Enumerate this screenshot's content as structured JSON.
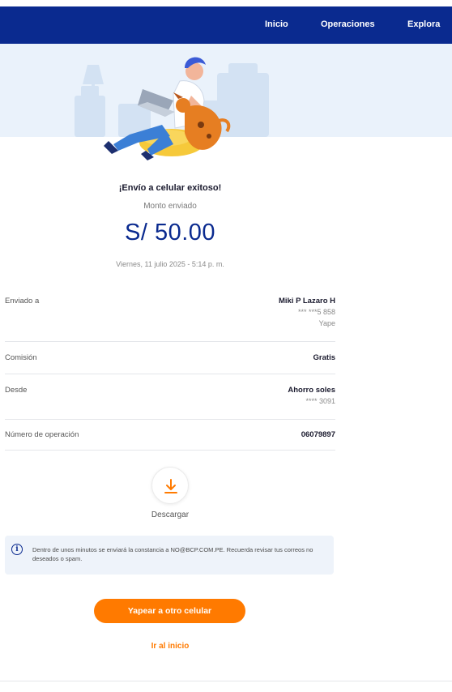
{
  "nav": {
    "items": [
      "Inicio",
      "Operaciones",
      "Explora"
    ]
  },
  "receipt": {
    "title": "¡Envío a celular exitoso!",
    "amount_label": "Monto enviado",
    "amount": "S/ 50.00",
    "datetime": "Viernes, 11 julio 2025 - 5:14 p. m."
  },
  "details": {
    "sent_to": {
      "label": "Enviado a",
      "name": "Miki P Lazaro H",
      "phone": "*** ***5 858",
      "app": "Yape"
    },
    "fee": {
      "label": "Comisión",
      "value": "Gratis"
    },
    "from": {
      "label": "Desde",
      "account": "Ahorro soles",
      "number": "**** 3091"
    },
    "operation": {
      "label": "Número de operación",
      "value": "06079897"
    }
  },
  "download": {
    "label": "Descargar",
    "icon": "download-icon"
  },
  "notice": {
    "icon": "info-icon",
    "text": "Dentro de unos minutos se enviará la constancia a NO@BCP.COM.PE. Recuerda revisar tus correos no deseados o spam."
  },
  "actions": {
    "primary": "Yapear a otro celular",
    "secondary": "Ir al inicio"
  },
  "colors": {
    "brand_blue": "#0a2a8f",
    "accent_orange": "#ff7a00",
    "banner_bg": "#eaf2fb"
  }
}
